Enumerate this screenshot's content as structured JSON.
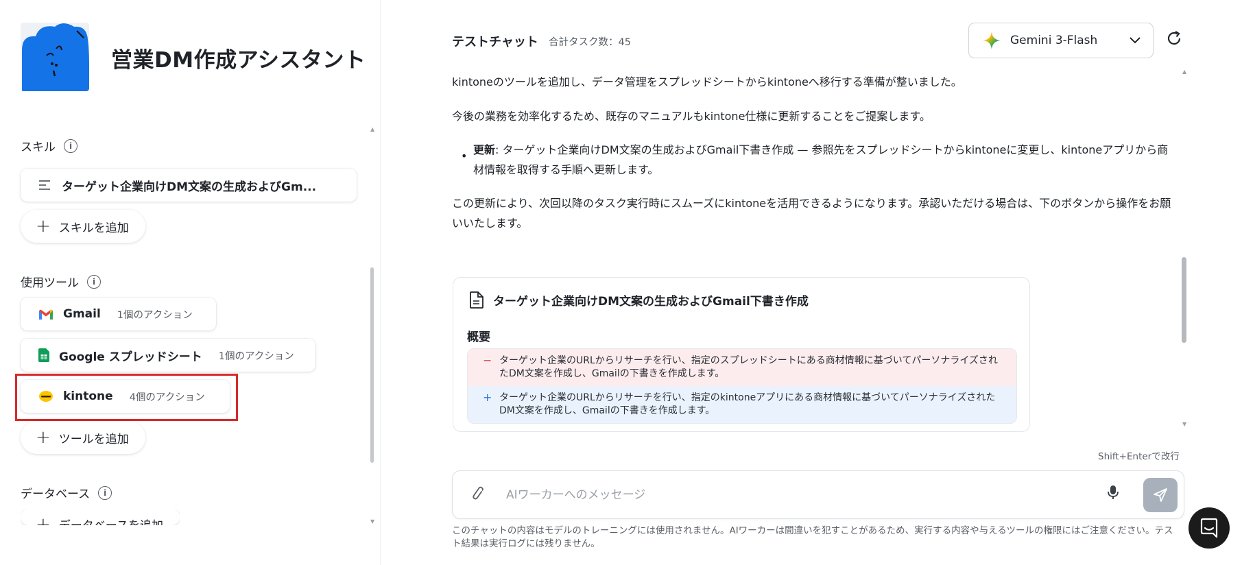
{
  "app": {
    "title": "営業DM作成アシスタント"
  },
  "sidebar": {
    "skills_label": "スキル",
    "skills": [
      {
        "label": "ターゲット企業向けDM文案の生成およびGm..."
      }
    ],
    "add_skill_label": "スキルを追加",
    "tools_label": "使用ツール",
    "tools": [
      {
        "name": "Gmail",
        "actions": "1個のアクション",
        "icon": "gmail-icon"
      },
      {
        "name": "Google スプレッドシート",
        "actions": "1個のアクション",
        "icon": "sheets-icon"
      },
      {
        "name": "kintone",
        "actions": "4個のアクション",
        "icon": "kintone-icon"
      }
    ],
    "add_tool_label": "ツールを追加",
    "database_label": "データベース",
    "add_database_label": "データベースを追加"
  },
  "chat": {
    "title": "テストチャット",
    "task_count": "合計タスク数：45",
    "model": "Gemini 3-Flash",
    "messages": {
      "p1": "kintoneのツールを追加し、データ管理をスプレッドシートからkintoneへ移行する準備が整いました。",
      "p2": "今後の業務を効率化するため、既存のマニュアルもkintone仕様に更新することをご提案します。",
      "bullet_bold": "更新",
      "bullet_text": ": ターゲット企業向けDM文案の生成およびGmail下書き作成 — 参照先をスプレッドシートからkintoneに変更し、kintoneアプリから商材情報を取得する手順へ更新します。",
      "p3": "この更新により、次回以降のタスク実行時にスムーズにkintoneを活用できるようになります。承認いただける場合は、下のボタンから操作をお願いいたします。"
    },
    "preview": {
      "title": "ターゲット企業向けDM文案の生成およびGmail下書き作成",
      "section": "概要",
      "removed": "ターゲット企業のURLからリサーチを行い、指定のスプレッドシートにある商材情報に基づいてパーソナライズされたDM文案を作成し、Gmailの下書きを作成します。",
      "added": "ターゲット企業のURLからリサーチを行い、指定のkintoneアプリにある商材情報に基づいてパーソナライズされたDM文案を作成し、Gmailの下書きを作成します。",
      "removed_sign": "−",
      "added_sign": "+"
    },
    "composer": {
      "hint": "Shift+Enterで改行",
      "placeholder": "AIワーカーへのメッセージ",
      "value": ""
    },
    "disclaimer": "このチャットの内容はモデルのトレーニングには使用されません。AIワーカーは間違いを犯すことがあるため、実行する内容や与えるツールの権限にはご注意ください。テスト結果は実行ログには残りません。"
  },
  "colors": {
    "highlight": "#d62b2b",
    "avatar_blue": "#1473e6",
    "send_button": "#a8b1bb"
  }
}
